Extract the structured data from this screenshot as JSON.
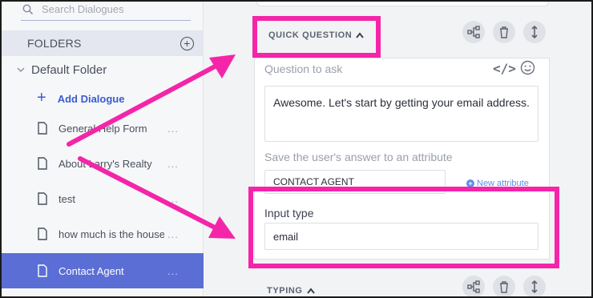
{
  "sidebar": {
    "search_placeholder": "Search Dialogues",
    "folders_title": "FOLDERS",
    "folder_name": "Default Folder",
    "add_dialogue_label": "Add Dialogue",
    "dialogues": [
      {
        "label": "General Help Form",
        "more": "..."
      },
      {
        "label": "About Larry's Realty",
        "more": "..."
      },
      {
        "label": "test",
        "more": "..."
      },
      {
        "label": "how much is the house",
        "more": "..."
      },
      {
        "label": "Contact Agent",
        "more": "...",
        "active": true
      }
    ]
  },
  "main": {
    "quick_question_title": "QUICK QUESTION",
    "question_label": "Question to ask",
    "question_text": "Awesome. Let's start by getting your email address.",
    "save_attr_label": "Save the user's answer to an attribute",
    "attribute_value": "CONTACT AGENT",
    "new_attribute_label": "New attribute",
    "input_type_label": "Input type",
    "input_type_value": "email",
    "typing_title": "TYPING"
  },
  "colors": {
    "highlight": "#f425a8",
    "active_item": "#5b6ed6",
    "link": "#3b5bd1"
  },
  "icons": [
    "search-icon",
    "plus-circle-icon",
    "chevron-down-icon",
    "plus-icon",
    "document-icon",
    "branch-icon",
    "trash-icon",
    "move-vertical-icon",
    "code-icon",
    "smiley-icon",
    "caret-up-icon"
  ]
}
